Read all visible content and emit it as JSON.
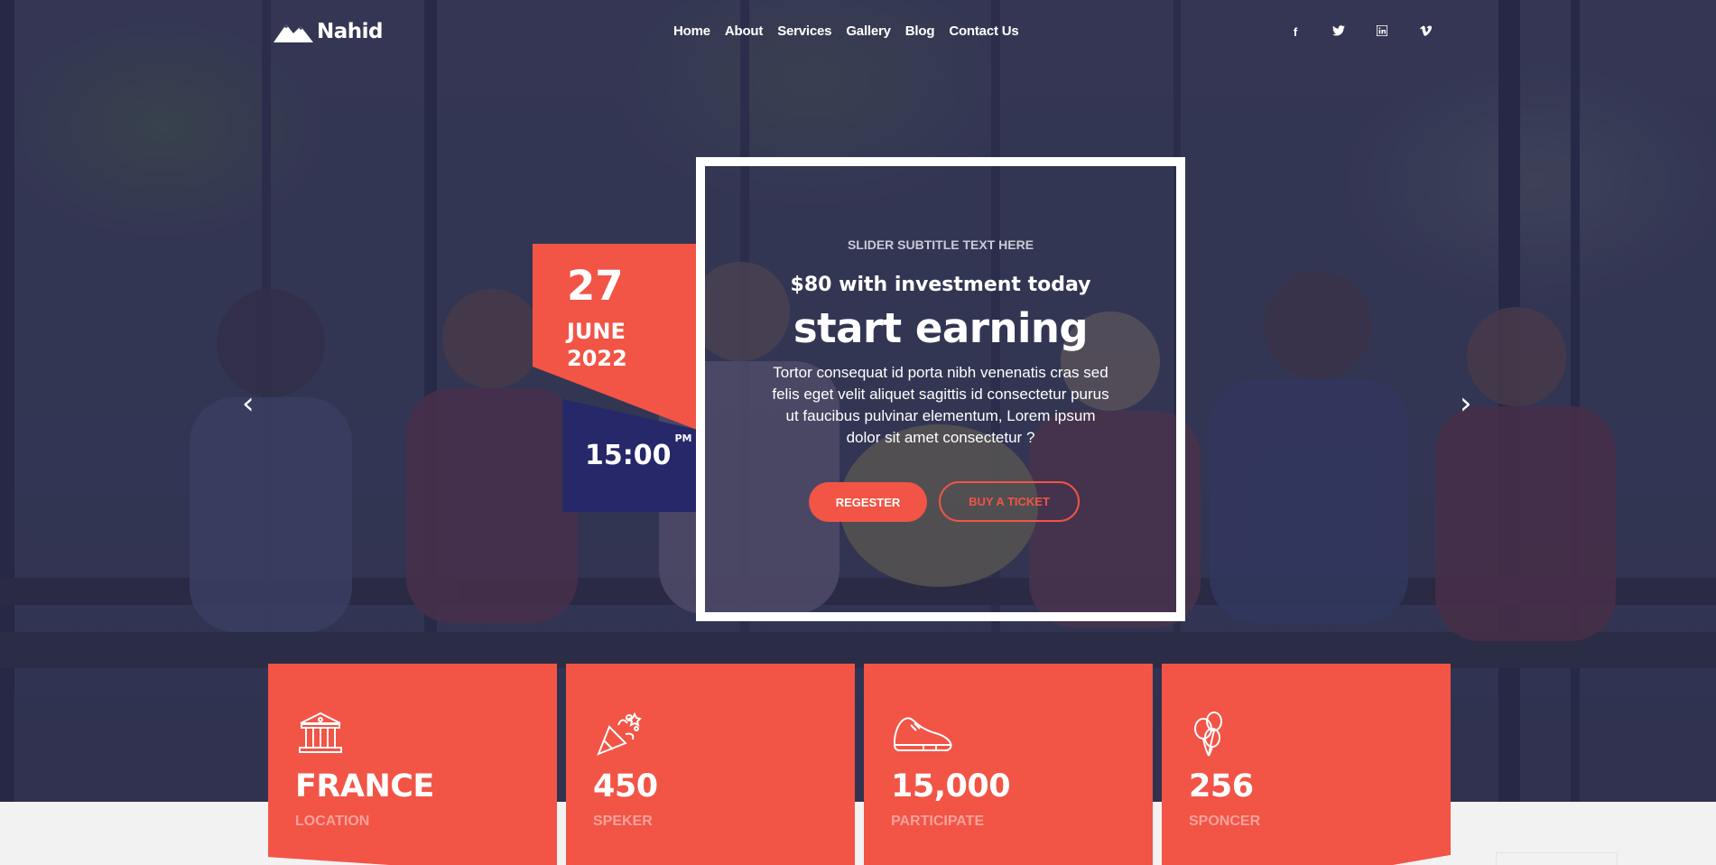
{
  "header": {
    "logo_text": "Nahid",
    "nav": [
      "Home",
      "About",
      "Services",
      "Gallery",
      "Blog",
      "Contact Us"
    ],
    "social": [
      "f",
      "t",
      "in",
      "v"
    ]
  },
  "slider": {
    "prev_arrow": "‹",
    "next_arrow": "›",
    "subtitle": "SLIDER SUBTITLE TEXT HERE",
    "kicker": "$80 with investment today",
    "headline": "start earning",
    "body": "Tortor consequat id porta nibh venenatis cras sed felis eget velit aliquet sagittis id consectetur purus ut faucibus pulvinar elementum, Lorem ipsum dolor sit amet consectetur ?",
    "register_label": "REGESTER",
    "ticket_label": "BUY A TICKET"
  },
  "event_date": {
    "day": "27",
    "month": "JUNE",
    "year": "2022",
    "time": "15:00",
    "meridiem": "PM"
  },
  "stats": [
    {
      "icon": "museum-icon",
      "value": "FRANCE",
      "label": "LOCATION"
    },
    {
      "icon": "party-popper-icon",
      "value": "450",
      "label": "SPEKER"
    },
    {
      "icon": "sneaker-icon",
      "value": "15,000",
      "label": "PARTICIPATE"
    },
    {
      "icon": "balloons-icon",
      "value": "256",
      "label": "SPONCER"
    }
  ],
  "colors": {
    "accent": "#f25446",
    "navy": "#26286a",
    "overlay": "#2c2e50"
  }
}
